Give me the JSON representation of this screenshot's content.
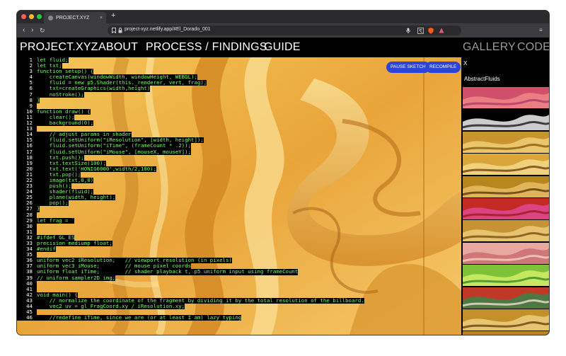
{
  "browser": {
    "tab_title": "PROJECT.XYZ",
    "tab_close": "×",
    "new_tab": "+",
    "url": "project-xyz.netlify.app/#El_Dorado_001",
    "back_glyph": "‹",
    "forward_glyph": "›",
    "reload_glyph": "↻",
    "menu_glyph": "≡",
    "traffic_lights": [
      "#ff5f57",
      "#febc2e",
      "#28c840"
    ]
  },
  "nav": {
    "brand": "PROJECT.XYZ",
    "about": "ABOUT",
    "process": "PROCESS / FINDINGS",
    "guide": "GUIDE",
    "gallery": "GALLERY",
    "code": "CODE"
  },
  "editor": {
    "pause_label": "PAUSE SKETCH",
    "recompile_label": "RECOMPILE",
    "lines": [
      "let fluid;",
      "let txt;",
      "function setup() {",
      "    createCanvas(windowWidth, windowHeight, WEBGL);",
      "    fluid = new p5.Shader(this._renderer, vert, frag);",
      "    txt=createGraphics(width,height)",
      "    noStroke();",
      "}",
      "",
      "function draw() {",
      "    clear();",
      "    background(0);",
      "",
      "    // adjust params in shader",
      "    fluid.setUniform(\"iResolution\", [width, height]);",
      "    fluid.setUniform(\"iTime\", (frameCount * .2));",
      "    fluid.setUniform(\"iMouse\", [mouseX, mouseY]);",
      "    txt.push();",
      "    txt.textSize(100);",
      "    txt.text('HONIG6000',width/2,100);",
      "    txt.pop();",
      "    image(txt,0,0)",
      "    push();",
      "    shader(fluid);",
      "    plane(width, height);",
      "    pop();",
      "}",
      "",
      "let frag = `",
      "",
      "",
      "#ifdef GL_ES",
      "precision mediump float;",
      "#endif",
      "",
      "uniform vec2 iResolution;   // viewport resolution (in pixels)",
      "uniform vec3 iMouse;        // mouse pixel coords",
      "uniform float iTime;        // shader playback t, p5 uniform input using frameCount",
      "// uniform sampler2D img;",
      "",
      "",
      "void main() {",
      "    // normalize the coordinate of the fragment by dividing it by the total resolution of the billboard.",
      "    vec2 uv = gl_FragCoord.xy / iResolution.xy;",
      "",
      "    //redefine iTime, since we are (or at least I am) lazy typing"
    ]
  },
  "sidebar": {
    "close_label": "X",
    "title": "AbstractFluids",
    "thumbnails": [
      {
        "name": "pink-coral-fluid",
        "colors": [
          "#d0506c",
          "#f08a8a",
          "#b03a6a"
        ]
      },
      {
        "name": "black-white-wave",
        "colors": [
          "#000000",
          "#ffffff",
          "#1a1a1a"
        ]
      },
      {
        "name": "gold-fluid-1",
        "colors": [
          "#c9932e",
          "#f2d27a",
          "#8a5a12"
        ]
      },
      {
        "name": "gold-fluid-2",
        "colors": [
          "#d9a63c",
          "#f6dc8c",
          "#6e4410"
        ]
      },
      {
        "name": "gold-fluid-3",
        "colors": [
          "#b8861f",
          "#e8c066",
          "#5c3a0c"
        ]
      },
      {
        "name": "red-magenta-fluid",
        "colors": [
          "#c42a24",
          "#e24a9a",
          "#9e1c1c"
        ]
      },
      {
        "name": "gold-fluid-4",
        "colors": [
          "#c89334",
          "#eecf7e",
          "#7a4c12"
        ]
      },
      {
        "name": "pink-peach-fluid",
        "colors": [
          "#e8a8a0",
          "#c86a6e",
          "#f4d0c4"
        ]
      },
      {
        "name": "green-lime-fluid",
        "colors": [
          "#7ec23a",
          "#d8f06a",
          "#3a8a2a"
        ]
      },
      {
        "name": "red-green-marble",
        "colors": [
          "#c03828",
          "#2e8a4a",
          "#f0e0d0"
        ]
      },
      {
        "name": "gold-fluid-5",
        "colors": [
          "#c4902c",
          "#f0d282",
          "#6a4010"
        ]
      },
      {
        "name": "gold-fluid-6",
        "colors": [
          "#b8842a",
          "#e6c26e",
          "#5a3a0e"
        ]
      }
    ]
  },
  "colors": {
    "code_green": "#7dfc6a",
    "button_blue": "#2c44d8",
    "gold": "#e7a838"
  }
}
